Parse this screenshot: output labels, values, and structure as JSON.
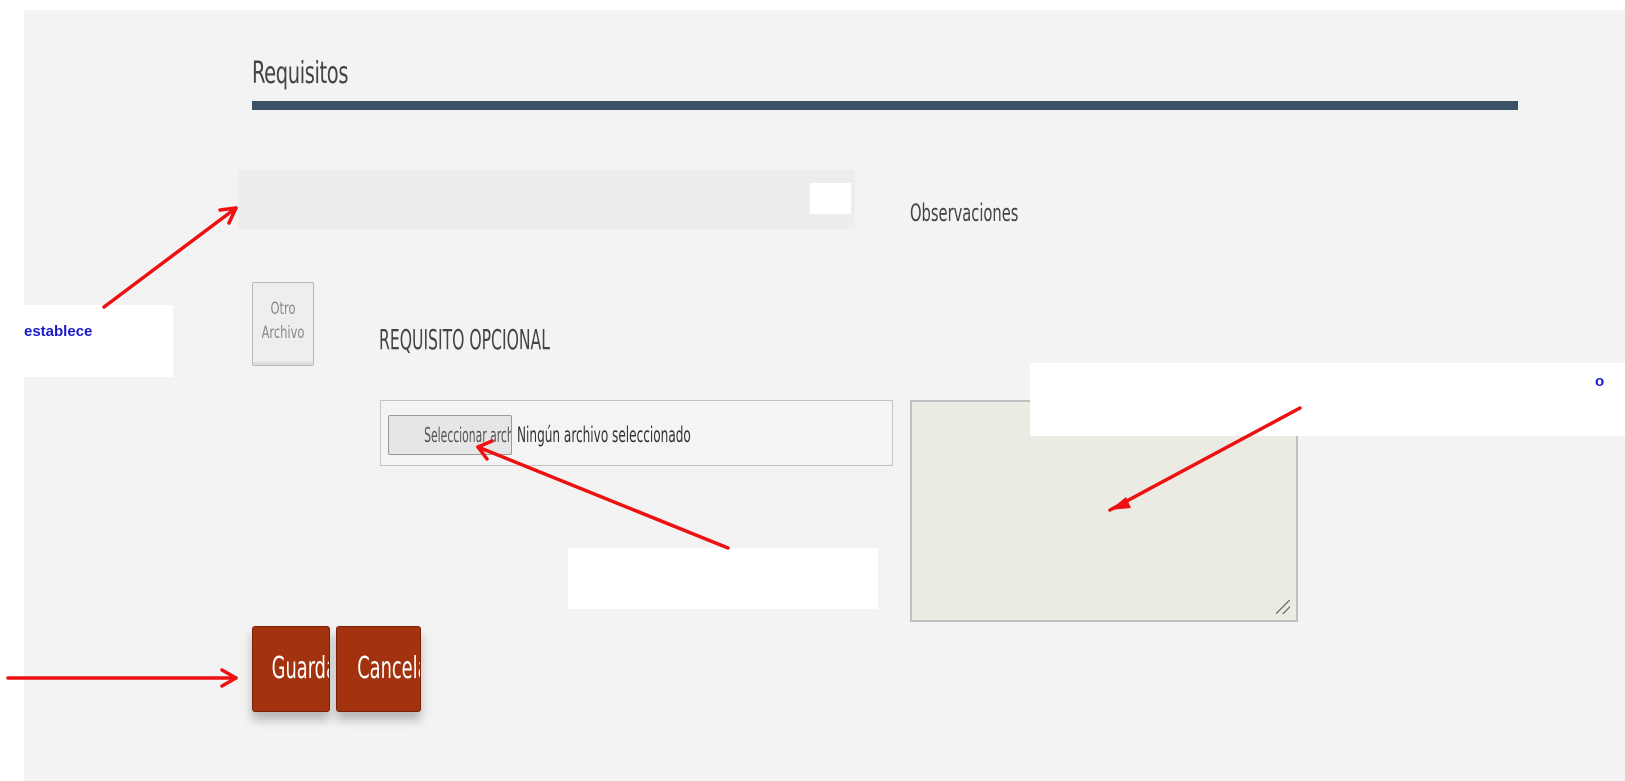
{
  "section": {
    "title": "Requisitos"
  },
  "observaciones": {
    "label": "Observaciones",
    "value": ""
  },
  "otro_archivo": {
    "line1": "Otro",
    "line2": "Archivo"
  },
  "requisito": {
    "label": "REQUISITO OPCIONAL",
    "file_button_label": "Seleccionar archivo",
    "file_status": "Ningún archivo seleccionado"
  },
  "actions": {
    "save_label": "Guardar",
    "cancel_label": "Cancelar"
  },
  "annotations": {
    "left_note": "establece",
    "right_note": "o"
  },
  "colors": {
    "title_bar": "#3c5066",
    "button_primary": "#a3320e",
    "annotation_arrow": "#ee1111",
    "annotation_text": "#1a1acc"
  }
}
